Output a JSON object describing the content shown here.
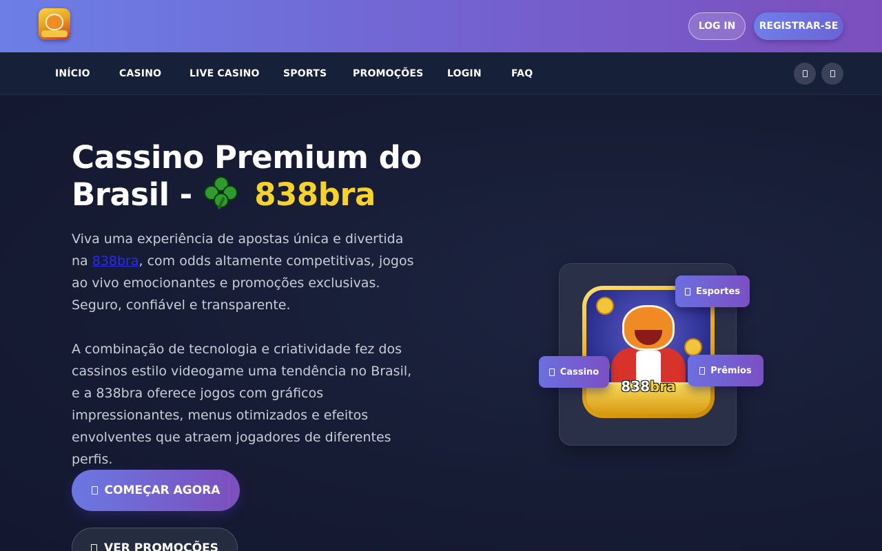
{
  "header": {
    "logo_alt": "838bra",
    "login_label": "LOG IN",
    "register_label": "REGISTRAR-SE"
  },
  "nav": {
    "items": [
      {
        "label": "INÍCIO"
      },
      {
        "label": "CASINO"
      },
      {
        "label": "LIVE CASINO"
      },
      {
        "label": "SPORTS"
      },
      {
        "label": "PROMOÇÕES"
      },
      {
        "label": "LOGIN"
      },
      {
        "label": "FAQ"
      }
    ],
    "icon_buttons": [
      "menu-icon",
      "user-icon"
    ]
  },
  "hero": {
    "title_part1": "Cassino Premium do",
    "title_part2": "Brasil -",
    "title_icon": "clover-icon",
    "title_brand": "838bra",
    "paragraph1_before": "Viva uma experiência de apostas única e divertida na ",
    "paragraph1_link": "838bra",
    "paragraph1_after": ", com odds altamente competitivas, jogos ao vivo emocionantes e promoções exclusivas. Seguro, confiável e transparente.",
    "paragraph2": "A combinação de tecnologia e criatividade fez dos cassinos estilo videogame uma tendência no Brasil, e a 838bra oferece jogos com gráficos impressionantes, menus otimizados e efeitos envolventes que atraem jogadores de diferentes perfis.",
    "cta_primary": "COMEÇAR AGORA",
    "cta_secondary": "VER PROMOÇÕES"
  },
  "showcase": {
    "game_label_main": "838",
    "game_label_accent": "bra",
    "badges": [
      {
        "label": "Esportes",
        "icon": "sports-icon"
      },
      {
        "label": "Cassino",
        "icon": "casino-icon"
      },
      {
        "label": "Prêmios",
        "icon": "trophy-icon"
      }
    ]
  },
  "colors": {
    "header_gradient_start": "#6c7fe6",
    "header_gradient_end": "#7c4fbd",
    "nav_bg": "#172039",
    "page_bg": "#141a30",
    "brand_yellow": "#f7d22a",
    "link_blue": "#2b2bf0"
  }
}
